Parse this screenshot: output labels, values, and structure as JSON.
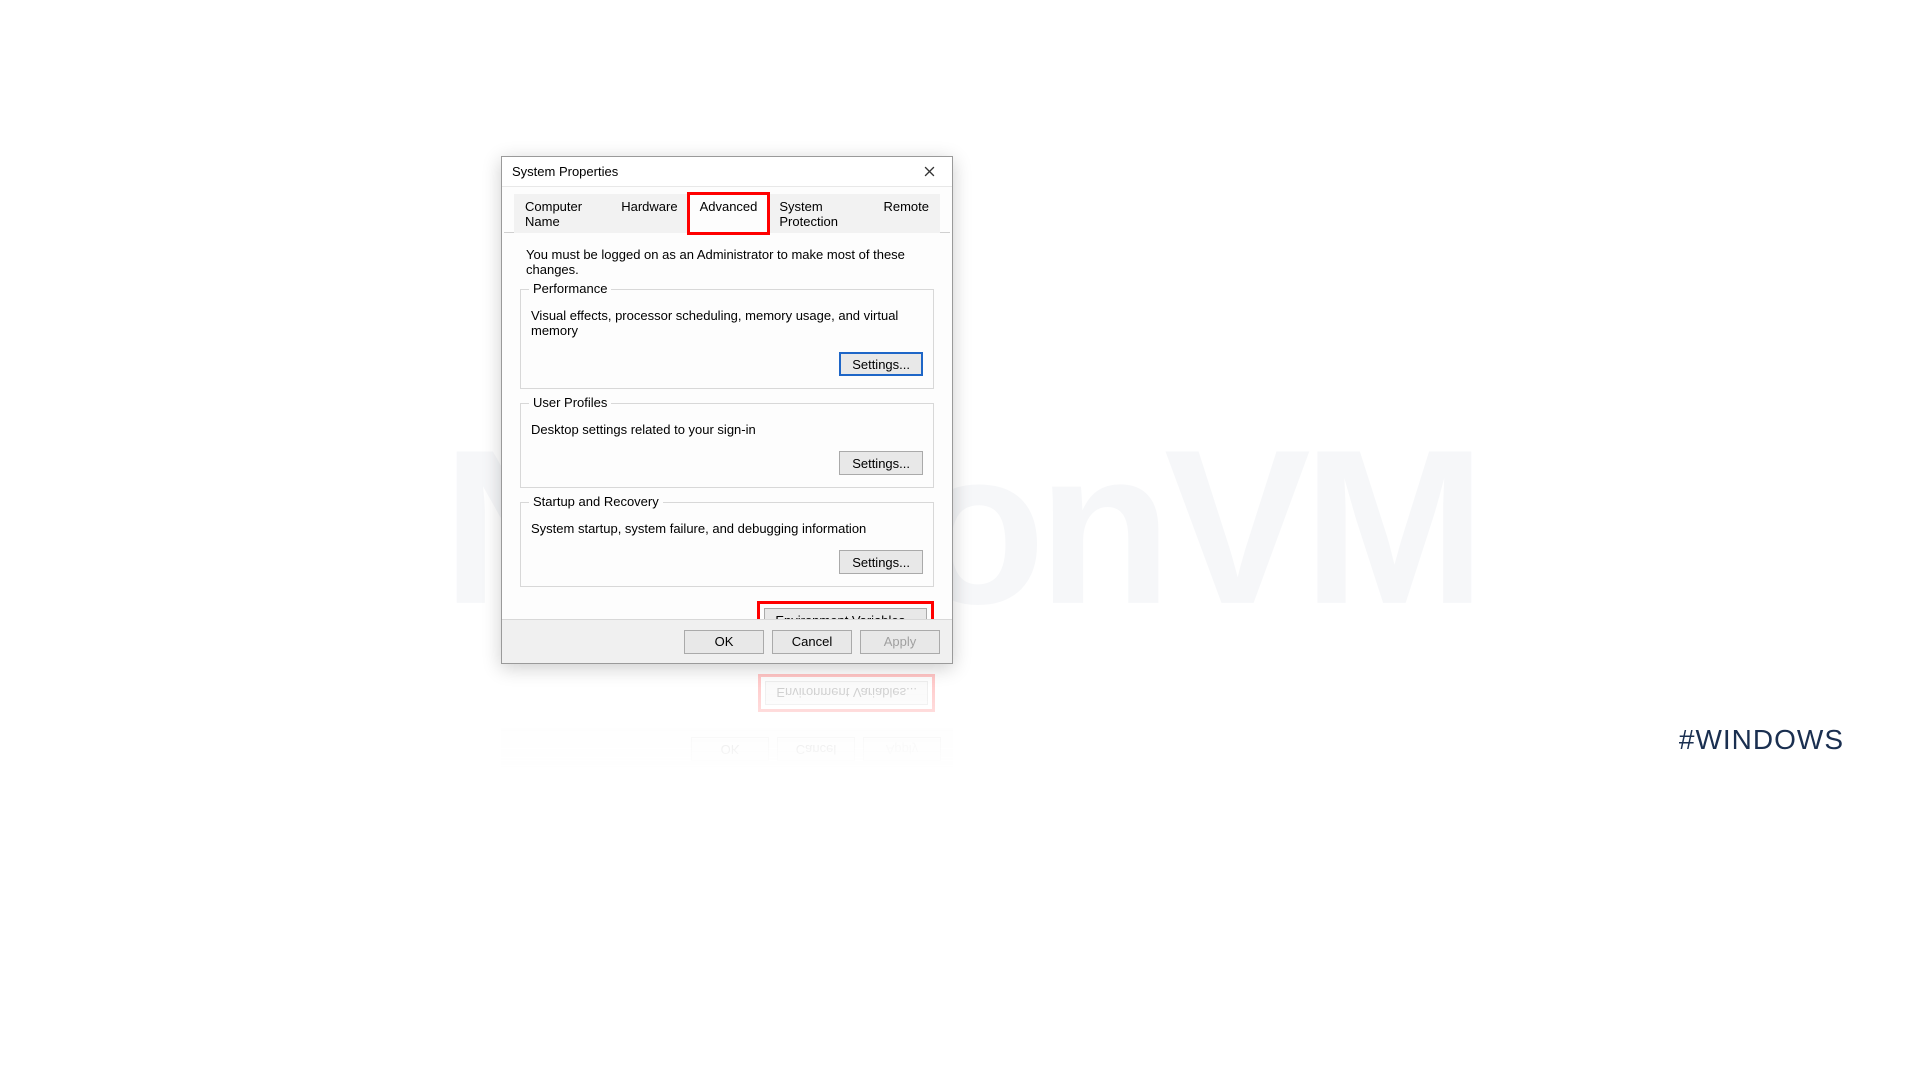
{
  "window": {
    "title": "System Properties"
  },
  "tabs": {
    "computer_name": "Computer Name",
    "hardware": "Hardware",
    "advanced": "Advanced",
    "system_protection": "System Protection",
    "remote": "Remote"
  },
  "intro": "You must be logged on as an Administrator to make most of these changes.",
  "groups": {
    "performance": {
      "legend": "Performance",
      "desc": "Visual effects, processor scheduling, memory usage, and virtual memory",
      "button": "Settings..."
    },
    "user_profiles": {
      "legend": "User Profiles",
      "desc": "Desktop settings related to your sign-in",
      "button": "Settings..."
    },
    "startup_recovery": {
      "legend": "Startup and Recovery",
      "desc": "System startup, system failure, and debugging information",
      "button": "Settings..."
    }
  },
  "env_button": "Environment Variables...",
  "footer": {
    "ok": "OK",
    "cancel": "Cancel",
    "apply": "Apply"
  },
  "watermark": "NeuronVM",
  "hashtag": "#WINDOWS"
}
